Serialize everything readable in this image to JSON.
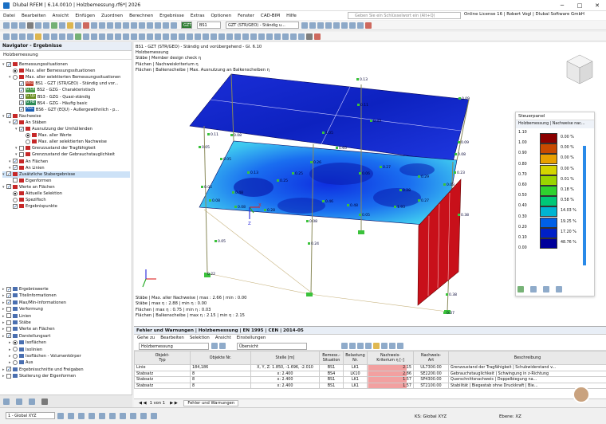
{
  "app": {
    "title": "Dlubal RFEM | 6.14.0010 | Holzbemessung.rf6*| 2026",
    "search_placeholder": "Geben Sie ein Schlüsselwort ein (Alt+Q)",
    "license": "Online License 16 | Robert Vogl | Dlubal Software GmbH"
  },
  "menu": [
    "Datei",
    "Bearbeiten",
    "Ansicht",
    "Einfügen",
    "Zuordnen",
    "Berechnen",
    "Ergebnisse",
    "Extras",
    "Optionen",
    "Fenster",
    "CAD-BIM",
    "Hilfe"
  ],
  "toolbar": {
    "bs_badge": "BS1",
    "gzt_combo": "GZT (STR/GEO) - Ständig u...",
    "bs_combo": "BS1",
    "bs_tag": "GZT",
    "view_combo": "1 - Global XYZ"
  },
  "nav": {
    "title": "Navigator - Ergebnisse",
    "subcombo": "Holzbemessung",
    "items": [
      "Bemessungssituationen",
      "Max. aller Bemessungssituationen",
      "Max. aller selektierten Bemessungssituationen",
      "BS1 - GZT (STR/GEO) - Ständig und vor...",
      "BS2 - GZG - Charakteristisch",
      "BS3 - GZG - Quasi-ständig",
      "BS4 - GZG - Häufig basic",
      "BS6 - GZT (EQU) - Außergewöhnlich - p...",
      "Nachweise",
      "An Stäben",
      "Ausnutzung der Umhüllenden",
      "Max. aller Werte",
      "Max. aller selektierten Nachweise",
      "Grenzzustand der Tragfähigkeit",
      "Grenzzustand der Gebrauchstauglichkeit",
      "An Flächen",
      "An Linien",
      "Zusätzliche Stabergebnisse",
      "Eigenformen",
      "Werte an Flächen",
      "Aktuelle Selektion",
      "Spezifisch",
      "Ergebnispunkte"
    ],
    "tags": [
      "BS1",
      "G Ch",
      "G Qp",
      "G Hb",
      "AGE"
    ],
    "items2": [
      "Ergebniswerte",
      "Titelinformationen",
      "Max/Min-Informationen",
      "Verformung",
      "Linien",
      "Stäbe",
      "Werte an Flächen",
      "Darstellungsart",
      "Isoflächen",
      "Isolinien",
      "Isoflächen - Volumenkörper",
      "Aus",
      "Ergebnisschnitte und Freigaben",
      "Skalierung der Eigenformen"
    ]
  },
  "viewport": {
    "info": [
      "BS1 - GZT (STR/GEO) - Ständig und vorübergehend - Gl. 6.10",
      "Holzbemessung",
      "Stäbe | Member design check η",
      "Flächen | Nachweiskriterium η",
      "Flächen | Balkenscheibe | Max. Ausnutzung an Balkenscheiben η"
    ],
    "footer": [
      "Stäbe | Max. aller Nachweise | max : 2.66 | min : 0.00",
      "Stäbe | max η : 2.88 | min η : 0.00",
      "Flächen | max η : 0.75 | min η : 0.03",
      "Flächen | Balkenscheibe | max η : 2.15 | min η : 2.15"
    ],
    "labels": [
      "0.13",
      "0.11",
      "0.09",
      "0.33",
      "0.05",
      "0.11",
      "0.05",
      "0.08",
      "0.09",
      "0.08",
      "0.23",
      "0.03",
      "0.65",
      "0.06",
      "0.05",
      "0.08",
      "0.38",
      "0.48",
      "0.08",
      "0.05",
      "0.08",
      "0.22",
      "0.38",
      "0.07",
      "1.05",
      "0.25",
      "0.25",
      "0.26",
      "0.27",
      "0.28",
      "0.29",
      "0.46",
      "0.48",
      "1.93",
      "0.13",
      "0.27",
      "0.28",
      "0.05",
      "0.24"
    ],
    "axis": [
      "X",
      "Y",
      "Z"
    ]
  },
  "steuer": {
    "title": "Steuerpanel",
    "sub": "Holzbemessung | Nachweise nac...",
    "legend": [
      {
        "v": "1.10",
        "c": "#8b0000",
        "p": "0.00 %"
      },
      {
        "v": "1.00",
        "c": "#c84a00",
        "p": "0.00 %"
      },
      {
        "v": "0.90",
        "c": "#e8a000",
        "p": "0.00 %"
      },
      {
        "v": "0.80",
        "c": "#d4d400",
        "p": "0.00 %"
      },
      {
        "v": "0.70",
        "c": "#9ad400",
        "p": "0.01 %"
      },
      {
        "v": "0.60",
        "c": "#2fd22f",
        "p": "0.18 %"
      },
      {
        "v": "0.50",
        "c": "#00c878",
        "p": "0.58 %"
      },
      {
        "v": "0.40",
        "c": "#00b4d2",
        "p": "14.03 %"
      },
      {
        "v": "0.30",
        "c": "#0060e8",
        "p": "19.25 %"
      },
      {
        "v": "0.20",
        "c": "#0020c8",
        "p": "17.20 %"
      },
      {
        "v": "0.10",
        "c": "#00009a",
        "p": "48.76 %"
      },
      {
        "v": "0.00",
        "c": "",
        "p": ""
      }
    ]
  },
  "panel": {
    "title": "Fehler und Warnungen | Holzbemessung | EN 1995 | CEN | 2014-05",
    "menu": [
      "Gehe zu",
      "Bearbeiten",
      "Selektion",
      "Ansicht",
      "Einstellungen"
    ],
    "combo1": "Holzbemessung",
    "combo2": "Übersicht",
    "headers": [
      "Objekt-\nTyp",
      "Objekte Nr.",
      "Stelle [m]",
      "Bemess.-\nSituation",
      "Belastung\nNr.",
      "Nachweis-\nKriterium η [-]",
      "Nachweis-\nArt",
      "Beschreibung"
    ],
    "rows": [
      [
        "Linie",
        "184,186",
        "X, Y, Z: 1.850, -1.696, -2.010",
        "BS1",
        "LK1",
        "2.15",
        "UL7300.00",
        "Grenzzustand der Tragfähigkeit | Schubwiderstand v..."
      ],
      [
        "Stabsatz",
        "8",
        "x: 2.400",
        "BS4",
        "LK10",
        "2.86",
        "SE2200.00",
        "Gebrauchstauglichkeit | Schwingung in z-Richtung"
      ],
      [
        "Stabsatz",
        "8",
        "x: 2.400",
        "BS1",
        "LK1",
        "1.57",
        "SP4300.00",
        "Querschnittsnachweis | Doppelbiegung na..."
      ],
      [
        "Stabsatz",
        "8",
        "x: 2.400",
        "BS1",
        "LK1",
        "1.57",
        "ST2100.00",
        "Stabilität | Biegestab ohne Druckkraft | Bie..."
      ]
    ],
    "pager": "1 von 1",
    "tab": "Fehler und Warnungen"
  },
  "status": {
    "ks": "KS: Global XYZ",
    "ebene": "Ebene: XZ"
  }
}
